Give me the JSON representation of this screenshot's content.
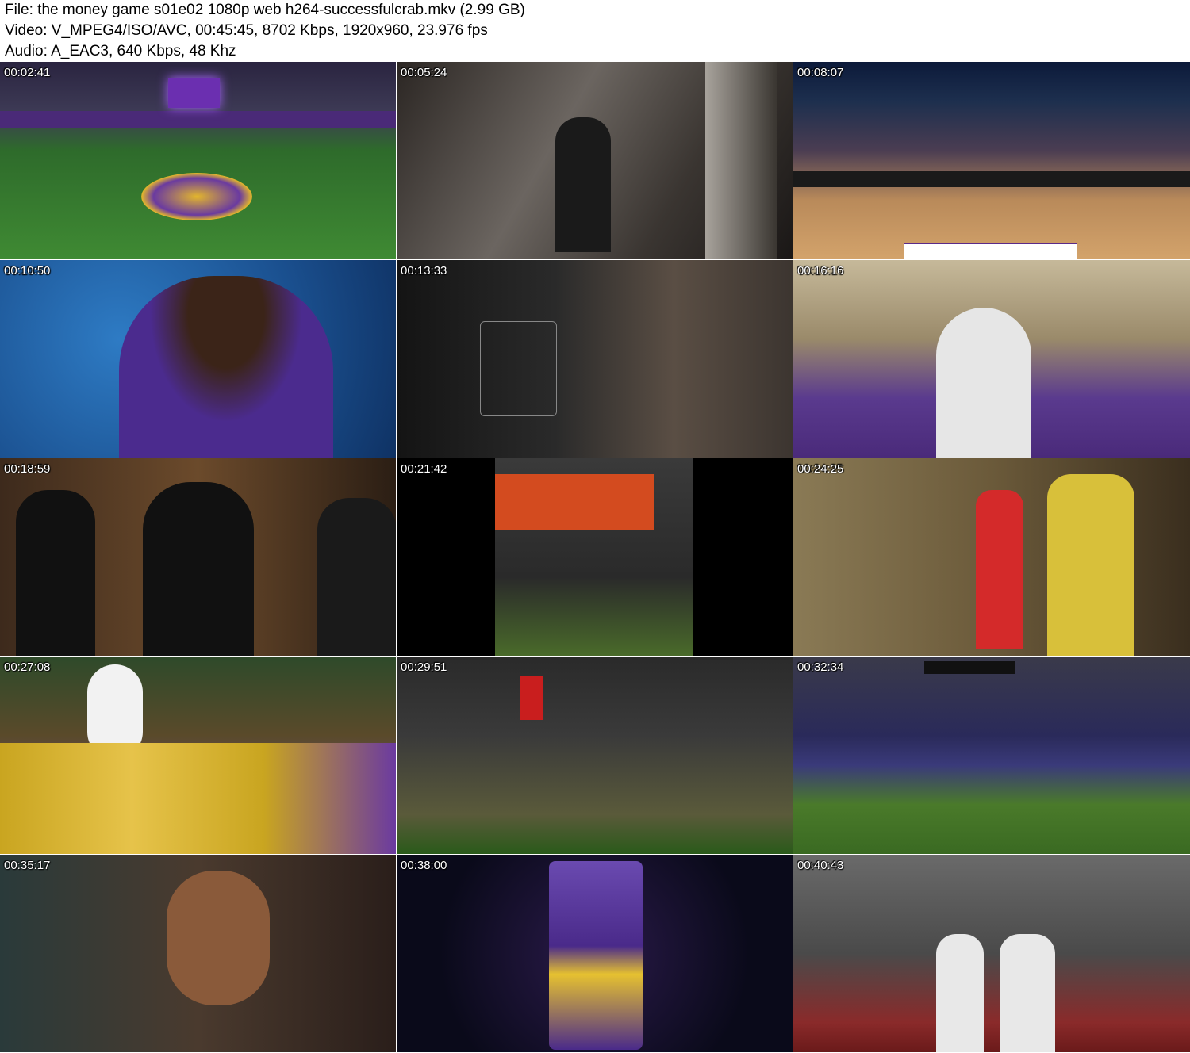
{
  "header": {
    "file_line": "File: the money game s01e02 1080p web h264-successfulcrab.mkv (2.99 GB)",
    "video_line": "Video: V_MPEG4/ISO/AVC, 00:45:45, 8702 Kbps, 1920x960, 23.976 fps",
    "audio_line": "Audio: A_EAC3, 640 Kbps, 48 Khz"
  },
  "thumbnails": [
    {
      "timestamp": "00:02:41"
    },
    {
      "timestamp": "00:05:24"
    },
    {
      "timestamp": "00:08:07"
    },
    {
      "timestamp": "00:10:50"
    },
    {
      "timestamp": "00:13:33"
    },
    {
      "timestamp": "00:16:16"
    },
    {
      "timestamp": "00:18:59"
    },
    {
      "timestamp": "00:21:42"
    },
    {
      "timestamp": "00:24:25"
    },
    {
      "timestamp": "00:27:08"
    },
    {
      "timestamp": "00:29:51"
    },
    {
      "timestamp": "00:32:34"
    },
    {
      "timestamp": "00:35:17"
    },
    {
      "timestamp": "00:38:00"
    },
    {
      "timestamp": "00:40:43"
    }
  ]
}
